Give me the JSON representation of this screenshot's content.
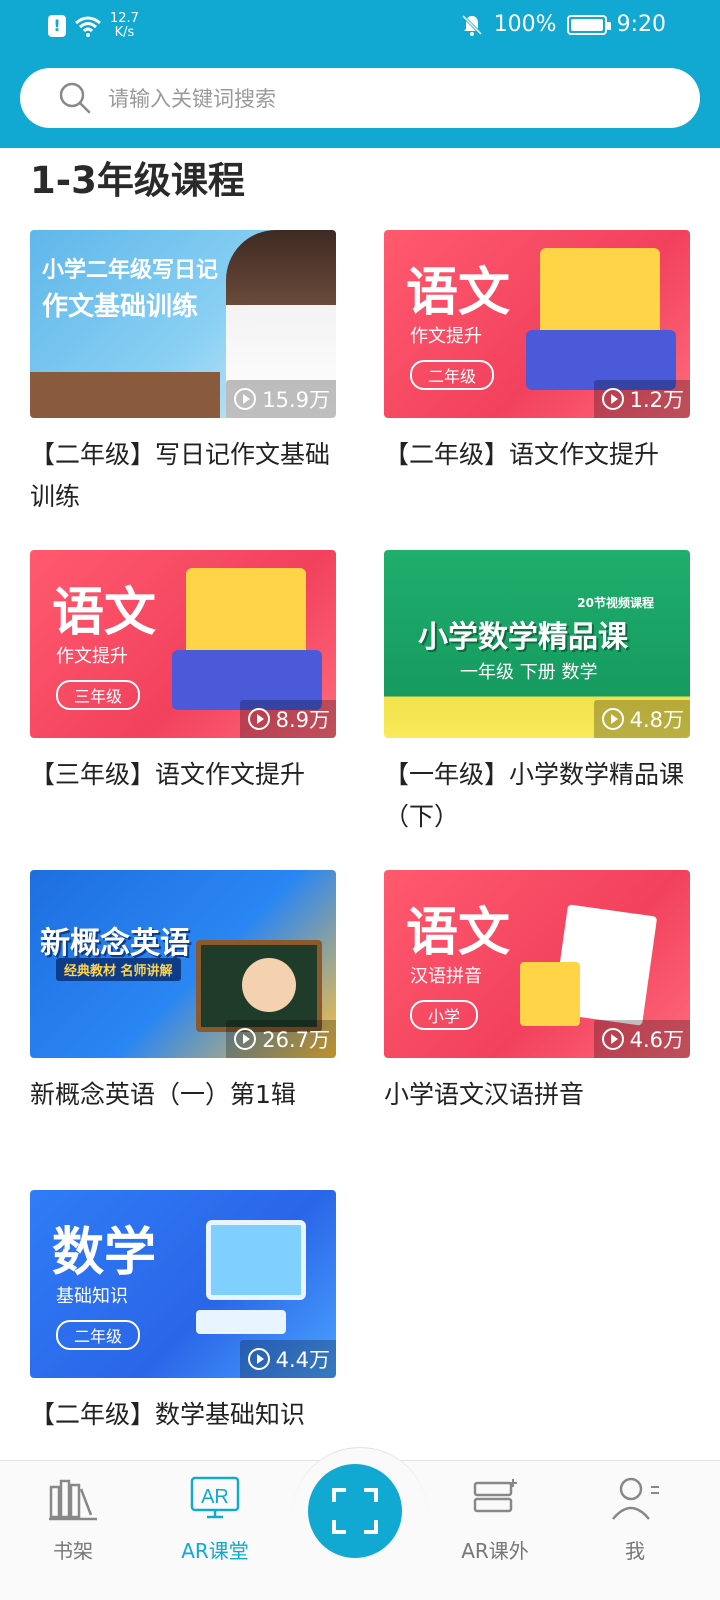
{
  "status_bar": {
    "speed": "12.7",
    "speed_unit": "K/s",
    "battery": "100%",
    "time": "9:20"
  },
  "search": {
    "placeholder": "请输入关键词搜索"
  },
  "section": {
    "title": "1-3年级课程"
  },
  "courses": [
    {
      "title": "【二年级】写日记作文基础训练",
      "views": "15.9万",
      "thumb_line1": "小学二年级写日记",
      "thumb_line2": "作文基础训练"
    },
    {
      "title": "【二年级】语文作文提升",
      "views": "1.2万",
      "thumb_subject": "语文",
      "thumb_sub": "作文提升",
      "thumb_tag": "二年级"
    },
    {
      "title": "【三年级】语文作文提升",
      "views": "8.9万",
      "thumb_subject": "语文",
      "thumb_sub": "作文提升",
      "thumb_tag": "三年级"
    },
    {
      "title": "【一年级】小学数学精品课（下）",
      "views": "4.8万",
      "thumb_badge": "20节视频课程",
      "thumb_main": "小学数学精品课",
      "thumb_sub": "一年级 下册 数学"
    },
    {
      "title": "新概念英语（一）第1辑",
      "views": "26.7万",
      "thumb_main": "新概念英语",
      "thumb_sub": "经典教材 名师讲解"
    },
    {
      "title": "小学语文汉语拼音",
      "views": "4.6万",
      "thumb_subject": "语文",
      "thumb_sub": "汉语拼音",
      "thumb_tag": "小学"
    },
    {
      "title": "【二年级】数学基础知识",
      "views": "4.4万",
      "thumb_subject": "数学",
      "thumb_sub": "基础知识",
      "thumb_tag": "二年级"
    }
  ],
  "nav": {
    "bookshelf": "书架",
    "ar_class": "AR课堂",
    "ar_extra": "AR课外",
    "me": "我",
    "active": "ar_class"
  },
  "colors": {
    "primary": "#11A8D2",
    "red_thumb": "#F2415D",
    "blue_thumb": "#2A66E8",
    "green_thumb": "#169A5F"
  }
}
